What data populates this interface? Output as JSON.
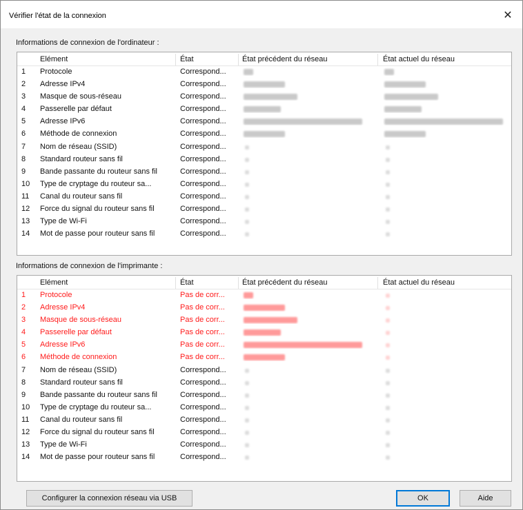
{
  "window": {
    "title": "Vérifier l'état de la connexion",
    "close_glyph": "✕"
  },
  "computer_section": {
    "label": "Informations de connexion de l'ordinateur :",
    "columns": [
      "Elément",
      "État",
      "État précédent du réseau",
      "État actuel du réseau"
    ],
    "rows": [
      {
        "num": "1",
        "element": "Protocole",
        "status": "Correspond..."
      },
      {
        "num": "2",
        "element": "Adresse IPv4",
        "status": "Correspond..."
      },
      {
        "num": "3",
        "element": "Masque de sous-réseau",
        "status": "Correspond..."
      },
      {
        "num": "4",
        "element": "Passerelle par défaut",
        "status": "Correspond..."
      },
      {
        "num": "5",
        "element": "Adresse IPv6",
        "status": "Correspond..."
      },
      {
        "num": "6",
        "element": "Méthode de connexion",
        "status": "Correspond..."
      },
      {
        "num": "7",
        "element": "Nom de réseau (SSID)",
        "status": "Correspond..."
      },
      {
        "num": "8",
        "element": "Standard routeur sans fil",
        "status": "Correspond..."
      },
      {
        "num": "9",
        "element": "Bande passante du routeur sans fil",
        "status": "Correspond..."
      },
      {
        "num": "10",
        "element": "Type de cryptage du routeur sa...",
        "status": "Correspond..."
      },
      {
        "num": "11",
        "element": "Canal du routeur sans fil",
        "status": "Correspond..."
      },
      {
        "num": "12",
        "element": "Force du signal du routeur sans fil",
        "status": "Correspond..."
      },
      {
        "num": "13",
        "element": "Type de Wi-Fi",
        "status": "Correspond..."
      },
      {
        "num": "14",
        "element": "Mot de passe pour routeur sans fil",
        "status": "Correspond..."
      }
    ]
  },
  "printer_section": {
    "label": "Informations de connexion de l'imprimante :",
    "columns": [
      "Elément",
      "État",
      "État précédent du réseau",
      "État actuel du réseau"
    ],
    "rows": [
      {
        "num": "1",
        "element": "Protocole",
        "status": "Pas de corr...",
        "error": true
      },
      {
        "num": "2",
        "element": "Adresse IPv4",
        "status": "Pas de corr...",
        "error": true
      },
      {
        "num": "3",
        "element": "Masque de sous-réseau",
        "status": "Pas de corr...",
        "error": true
      },
      {
        "num": "4",
        "element": "Passerelle par défaut",
        "status": "Pas de corr...",
        "error": true
      },
      {
        "num": "5",
        "element": "Adresse IPv6",
        "status": "Pas de corr...",
        "error": true
      },
      {
        "num": "6",
        "element": "Méthode de connexion",
        "status": "Pas de corr...",
        "error": true
      },
      {
        "num": "7",
        "element": "Nom de réseau (SSID)",
        "status": "Correspond..."
      },
      {
        "num": "8",
        "element": "Standard routeur sans fil",
        "status": "Correspond..."
      },
      {
        "num": "9",
        "element": "Bande passante du routeur sans fil",
        "status": "Correspond..."
      },
      {
        "num": "10",
        "element": "Type de cryptage du routeur sa...",
        "status": "Correspond..."
      },
      {
        "num": "11",
        "element": "Canal du routeur sans fil",
        "status": "Correspond..."
      },
      {
        "num": "12",
        "element": "Force du signal du routeur sans fil",
        "status": "Correspond..."
      },
      {
        "num": "13",
        "element": "Type de Wi-Fi",
        "status": "Correspond..."
      },
      {
        "num": "14",
        "element": "Mot de passe pour routeur sans fil",
        "status": "Correspond..."
      }
    ]
  },
  "buttons": {
    "usb_label": "Configurer la connexion réseau via USB",
    "ok_label": "OK",
    "help_label": "Aide"
  },
  "colors": {
    "error_text": "#ff1a1a",
    "default_button_border": "#0078d7"
  }
}
